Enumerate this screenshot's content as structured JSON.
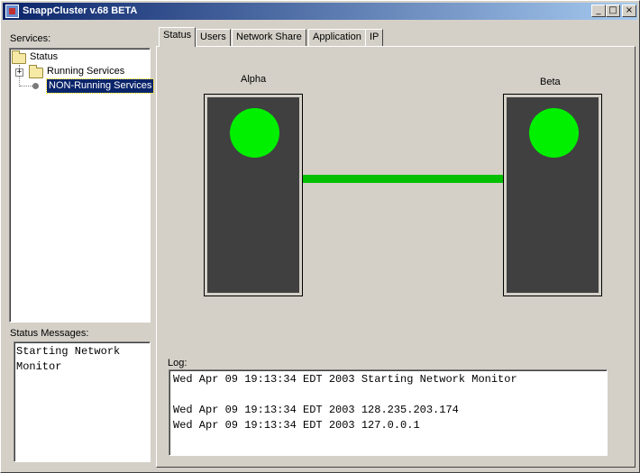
{
  "window": {
    "title": "SnappCluster v.68 BETA",
    "buttons": {
      "minimize": "_",
      "maximize": "□",
      "close": "×"
    }
  },
  "services": {
    "label": "Services:",
    "tree": {
      "root": "Status",
      "expander": "+",
      "children": [
        "Running Services",
        "NON-Running Services"
      ]
    }
  },
  "status_messages": {
    "label": "Status Messages:",
    "lines": [
      "Starting Network",
      "Monitor"
    ]
  },
  "tabs": [
    "Status",
    "Users",
    "Network Share",
    "Application",
    "IP"
  ],
  "active_tab": "Status",
  "cluster": {
    "nodes": [
      {
        "name": "Alpha",
        "status_color": "#00f000"
      },
      {
        "name": "Beta",
        "status_color": "#00f000"
      }
    ],
    "link_color": "#00c000"
  },
  "log": {
    "label": "Log:",
    "lines": [
      "Wed Apr 09 19:13:34 EDT 2003 Starting Network Monitor",
      "",
      "Wed Apr 09 19:13:34 EDT 2003 128.235.203.174",
      "Wed Apr 09 19:13:34 EDT 2003 127.0.0.1"
    ]
  },
  "colors": {
    "titlebar_start": "#0a246a",
    "titlebar_end": "#a6caf0",
    "selection": "#0a246a",
    "node_body": "#404040"
  }
}
